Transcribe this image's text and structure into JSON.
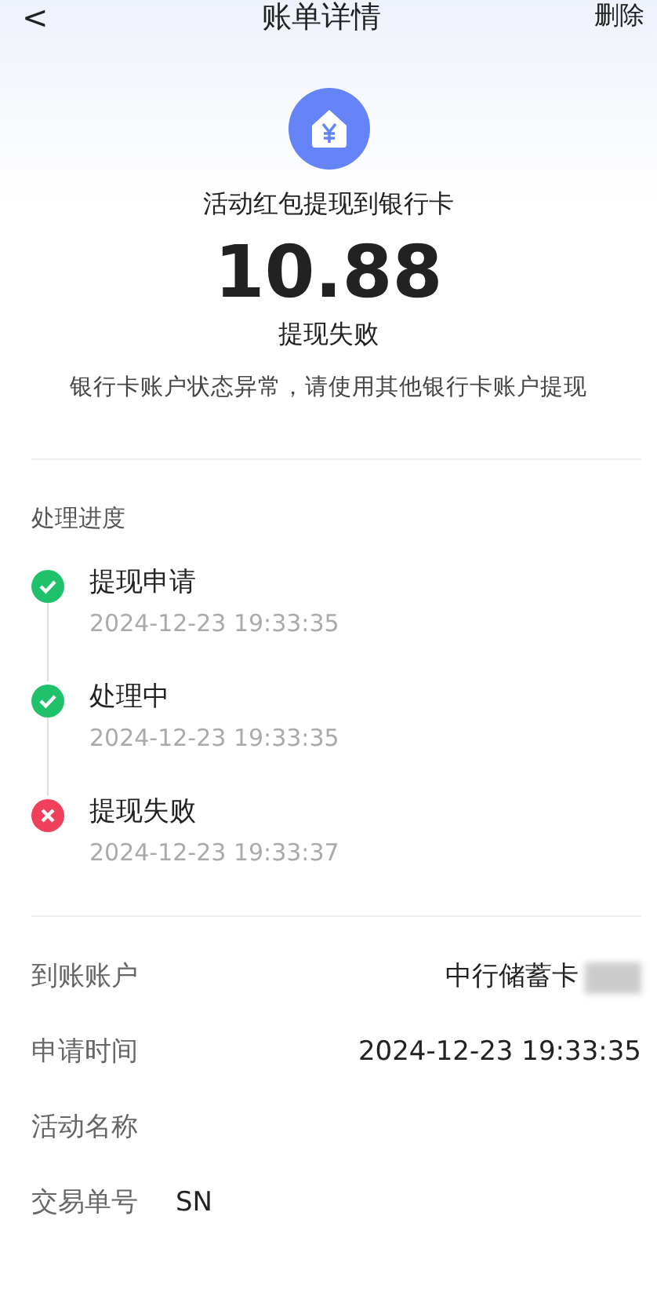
{
  "header": {
    "back": "<",
    "title": "账单详情",
    "action": "删除"
  },
  "summary": {
    "title": "活动红包提现到银行卡",
    "amount": "10.88",
    "status": "提现失败",
    "message": "银行卡账户状态异常，请使用其他银行卡账户提现"
  },
  "progress": {
    "title": "处理进度",
    "steps": [
      {
        "label": "提现申请",
        "time": "2024-12-23 19:33:35",
        "kind": "done"
      },
      {
        "label": "处理中",
        "time": "2024-12-23 19:33:35",
        "kind": "done"
      },
      {
        "label": "提现失败",
        "time": "2024-12-23 19:33:37",
        "kind": "failed"
      }
    ]
  },
  "details": [
    {
      "label": "到账账户",
      "value": "中行储蓄卡",
      "masked": true
    },
    {
      "label": "申请时间",
      "value": "2024-12-23 19:33:35",
      "masked": false
    },
    {
      "label": "活动名称",
      "masked": false
    },
    {
      "label": "交易单号",
      "value": "SN",
      "masked": false
    }
  ]
}
